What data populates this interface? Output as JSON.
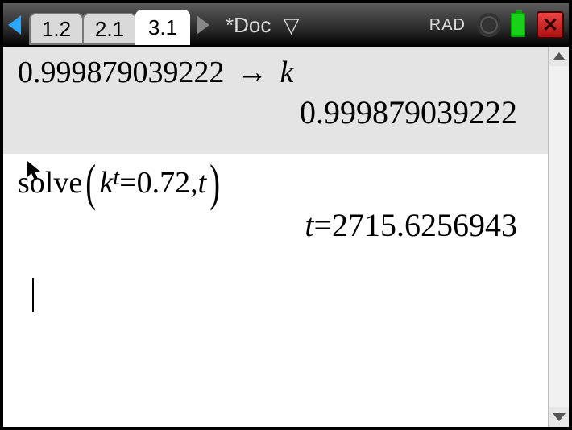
{
  "titlebar": {
    "tabs": [
      "1.2",
      "2.1",
      "3.1"
    ],
    "active_tab_index": 2,
    "doc_name": "*Doc",
    "angle_mode": "RAD",
    "close_glyph": "✕"
  },
  "history": [
    {
      "input_lhs": "0.999879039222",
      "store_var": "k",
      "output": "0.999879039222"
    },
    {
      "solve_fn": "solve",
      "base_var": "k",
      "exp_var": "t",
      "rhs": "0.72",
      "solve_for": "t",
      "result_var": "t",
      "result_val": "2715.6256943"
    }
  ],
  "icons": {
    "store_arrow": "→",
    "cursor_pointer": "↖",
    "dropdown": "▽"
  }
}
